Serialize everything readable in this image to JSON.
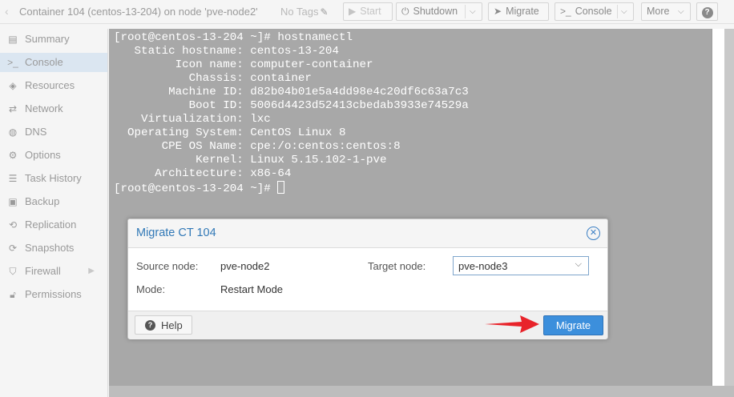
{
  "toolbar": {
    "title": "Container 104 (centos-13-204) on node 'pve-node2'",
    "tags": "No Tags",
    "start": "Start",
    "shutdown": "Shutdown",
    "migrate": "Migrate",
    "console": "Console",
    "more": "More",
    "help": "?"
  },
  "sidebar": {
    "items": [
      {
        "label": "Summary",
        "icon": "summary-icon"
      },
      {
        "label": "Console",
        "icon": "console-icon",
        "glyph": ">_"
      },
      {
        "label": "Resources",
        "icon": "resources-icon"
      },
      {
        "label": "Network",
        "icon": "network-icon"
      },
      {
        "label": "DNS",
        "icon": "dns-icon"
      },
      {
        "label": "Options",
        "icon": "gear-icon"
      },
      {
        "label": "Task History",
        "icon": "task-history-icon"
      },
      {
        "label": "Backup",
        "icon": "backup-icon"
      },
      {
        "label": "Replication",
        "icon": "replication-icon"
      },
      {
        "label": "Snapshots",
        "icon": "snapshots-icon"
      },
      {
        "label": "Firewall",
        "icon": "firewall-icon"
      },
      {
        "label": "Permissions",
        "icon": "permissions-icon"
      }
    ],
    "active": "Console"
  },
  "terminal": {
    "lines": [
      "[root@centos-13-204 ~]# hostnamectl",
      "   Static hostname: centos-13-204",
      "         Icon name: computer-container",
      "           Chassis: container",
      "        Machine ID: d82b04b01e5a4dd98e4c20df6c63a7c3",
      "           Boot ID: 5006d4423d52413cbedab3933e74529a",
      "    Virtualization: lxc",
      "  Operating System: CentOS Linux 8",
      "       CPE OS Name: cpe:/o:centos:centos:8",
      "            Kernel: Linux 5.15.102-1-pve",
      "      Architecture: x86-64"
    ],
    "prompt": "[root@centos-13-204 ~]# "
  },
  "dialog": {
    "title": "Migrate CT 104",
    "source_label": "Source node:",
    "source_value": "pve-node2",
    "mode_label": "Mode:",
    "mode_value": "Restart Mode",
    "target_label": "Target node:",
    "target_value": "pve-node3",
    "help": "Help",
    "migrate": "Migrate"
  },
  "colors": {
    "accent": "#3c8fdc",
    "title": "#3279b7",
    "arrow": "#e8232a"
  }
}
